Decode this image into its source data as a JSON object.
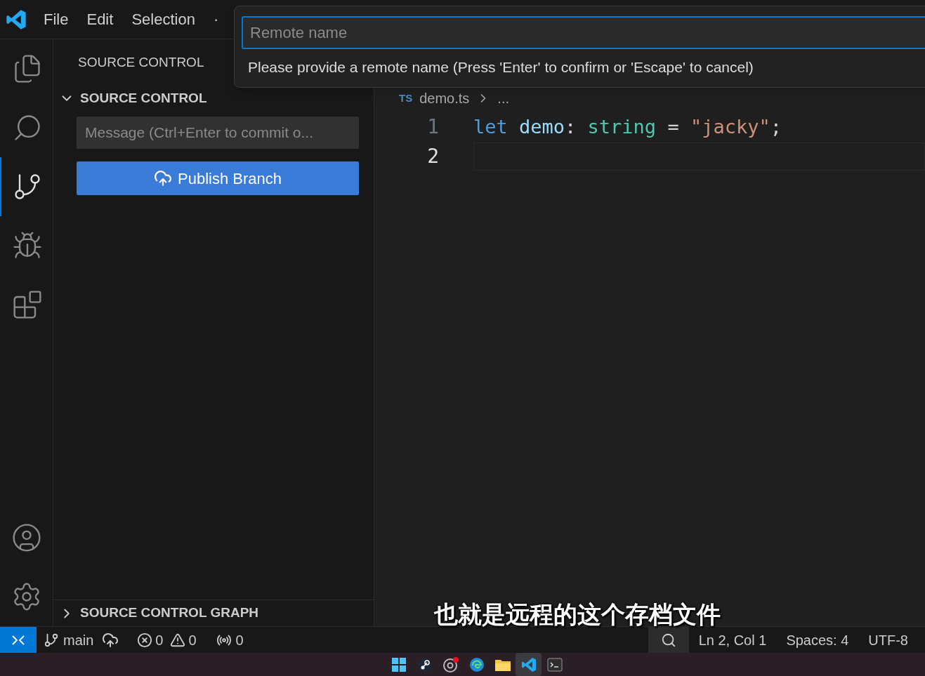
{
  "menu": [
    "File",
    "Edit",
    "Selection",
    "·"
  ],
  "quick_input": {
    "placeholder": "Remote name",
    "message": "Please provide a remote name (Press 'Enter' to confirm or 'Escape' to cancel)"
  },
  "activity_bar": [
    {
      "kind": "files",
      "selected": false
    },
    {
      "kind": "search",
      "selected": false
    },
    {
      "kind": "source-control",
      "selected": true
    },
    {
      "kind": "run-debug",
      "selected": false
    },
    {
      "kind": "extensions",
      "selected": false
    }
  ],
  "sidebar": {
    "title": "SOURCE CONTROL",
    "section": {
      "title": "SOURCE CONTROL",
      "expanded": true
    },
    "message": {
      "placeholder": "Message (Ctrl+Enter to commit o..."
    },
    "publish_button": "Publish Branch",
    "graph": {
      "title": "SOURCE CONTROL GRAPH",
      "expanded": false
    }
  },
  "editor": {
    "breadcrumb": {
      "badge": "TS",
      "file": "demo.ts",
      "rest": "..."
    },
    "lines": [
      {
        "number": "1",
        "tokens": [
          {
            "kind": "keyword",
            "text": "let"
          },
          {
            "kind": "variable",
            "text": " demo"
          },
          {
            "kind": "punct",
            "text": ": "
          },
          {
            "kind": "type",
            "text": "string"
          },
          {
            "kind": "punct",
            "text": " = "
          },
          {
            "kind": "string",
            "text": "\"jacky\""
          },
          {
            "kind": "punct",
            "text": ";"
          }
        ],
        "current": false
      },
      {
        "number": "2",
        "current": true
      }
    ]
  },
  "status_bar": {
    "branch": "main",
    "errors": "0",
    "warnings": "0",
    "ports": "0",
    "position": "Ln 2, Col 1",
    "spaces": "Spaces: 4",
    "encoding": "UTF-8"
  },
  "subtitle": "也就是远程的这个存档文件",
  "taskbar": [
    {
      "kind": "start"
    },
    {
      "kind": "steam"
    },
    {
      "kind": "chrome",
      "badge": true
    },
    {
      "kind": "edge"
    },
    {
      "kind": "folder"
    },
    {
      "kind": "vscode",
      "selected": true
    },
    {
      "kind": "terminal"
    }
  ]
}
